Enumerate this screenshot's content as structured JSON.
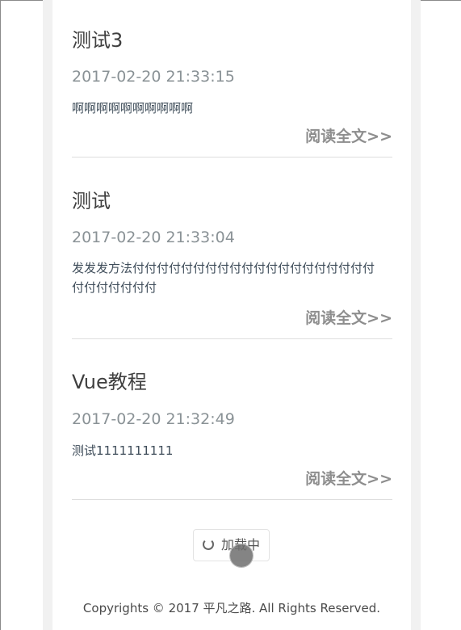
{
  "articles": [
    {
      "title": "测试3",
      "date": "2017-02-20 21:33:15",
      "excerpt": "啊啊啊啊啊啊啊啊啊啊",
      "read_more": "阅读全文>>"
    },
    {
      "title": "测试",
      "date": "2017-02-20 21:33:04",
      "excerpt": "发发发方法付付付付付付付付付付付付付付付付付付付付付付付付付付付",
      "read_more": "阅读全文>>"
    },
    {
      "title": "Vue教程",
      "date": "2017-02-20 21:32:49",
      "excerpt": "测试1111111111",
      "read_more": "阅读全文>>"
    }
  ],
  "load_more": {
    "label": "加载中",
    "icon": "spinner-icon"
  },
  "footer": {
    "copyright": "Copyrights © 2017 平凡之路. All Rights Reserved."
  },
  "colors": {
    "title": "#3f3f3f",
    "date": "#8a9296",
    "read_more": "#8e8e8e",
    "excerpt": "#3f4d5a",
    "divider": "#dedede"
  }
}
